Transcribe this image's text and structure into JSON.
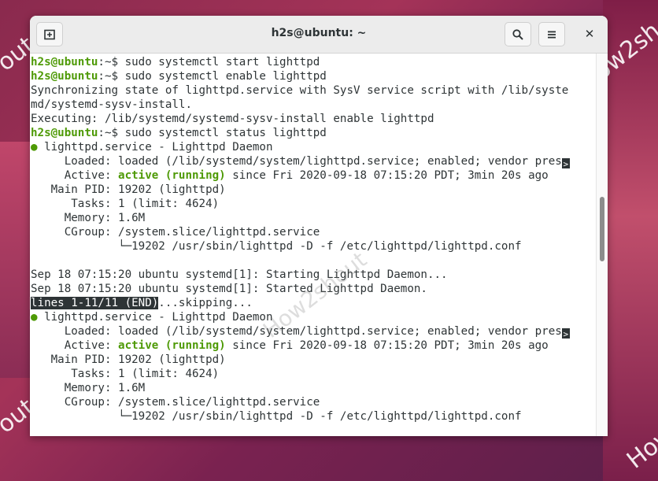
{
  "watermarks": {
    "left_top": "out",
    "right_top": "How2sh",
    "left_bottom": "out",
    "right_bottom": "How",
    "center": "How2shout"
  },
  "window": {
    "title": "h2s@ubuntu: ~",
    "buttons": {
      "new_tab": "new-tab-icon",
      "search": "search-icon",
      "menu": "hamburger-menu-icon",
      "close": "✕"
    }
  },
  "terminal": {
    "prompt": "h2s@ubuntu",
    "prompt_suffix": ":~$ ",
    "lines": {
      "cmd1": "sudo systemctl start lighttpd",
      "cmd2": "sudo systemctl enable lighttpd",
      "out1": "Synchronizing state of lighttpd.service with SysV service script with /lib/syste",
      "out2": "md/systemd-sysv-install.",
      "out3": "Executing: /lib/systemd/systemd-sysv-install enable lighttpd",
      "cmd3": "sudo systemctl status lighttpd"
    },
    "status_block": {
      "bullet": "●",
      "service": " lighttpd.service - Lighttpd Daemon",
      "loaded": "     Loaded: loaded (/lib/systemd/system/lighttpd.service; enabled; vendor pres",
      "active_label": "     Active: ",
      "active_value": "active (running)",
      "active_rest": " since Fri 2020-09-18 07:15:20 PDT; 3min 20s ago",
      "main_pid": "   Main PID: 19202 (lighttpd)",
      "tasks": "      Tasks: 1 (limit: 4624)",
      "memory": "     Memory: 1.6M",
      "cgroup": "     CGroup: /system.slice/lighttpd.service",
      "cgroup_child": "             └─19202 /usr/sbin/lighttpd -D -f /etc/lighttpd/lighttpd.conf"
    },
    "log1": "Sep 18 07:15:20 ubuntu systemd[1]: Starting Lighttpd Daemon...",
    "log2": "Sep 18 07:15:20 ubuntu systemd[1]: Started Lighttpd Daemon.",
    "pager_status": "lines 1-11/11 (END)",
    "pager_rest": "...skipping...",
    "overflow_marker": ">"
  }
}
